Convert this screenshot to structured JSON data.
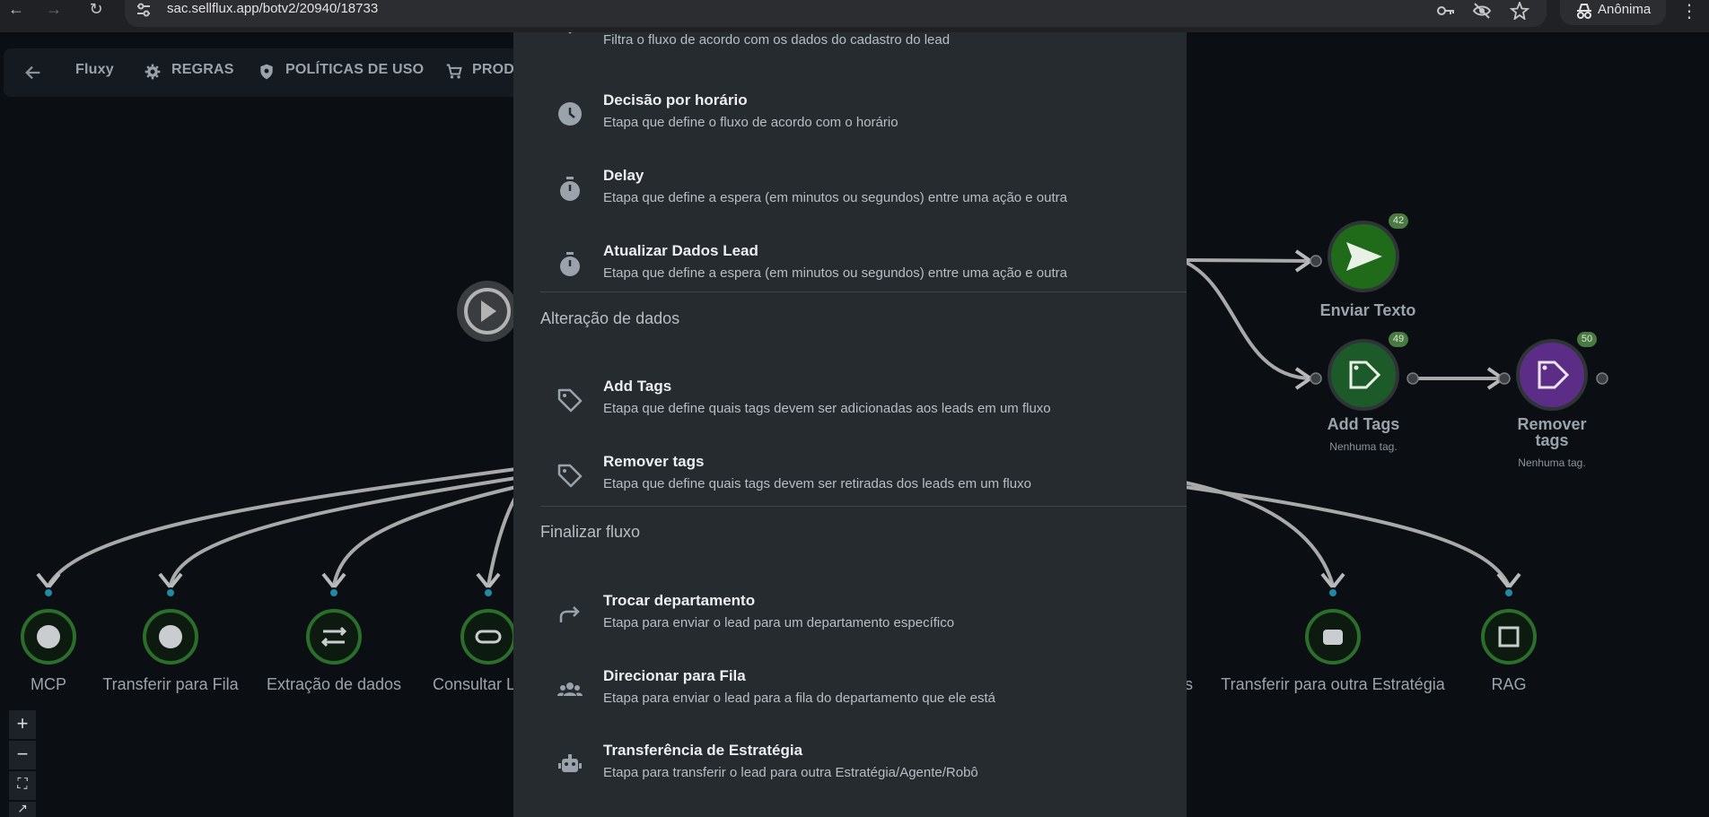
{
  "browser": {
    "url": "sac.sellflux.app/botv2/20940/18733",
    "profile_label": "Anônima"
  },
  "header": {
    "title": "Fluxy",
    "rules_label": "REGRAS",
    "policies_label": "POLÍTICAS DE USO",
    "products_label": "PROD"
  },
  "menu": {
    "top_partial_desc": "Filtra o fluxo de acordo com os dados do cadastro do lead",
    "group1_items": [
      {
        "title": "Decisão por horário",
        "desc": "Etapa que define o fluxo de acordo com o horário",
        "icon": "clock-icon"
      },
      {
        "title": "Delay",
        "desc": "Etapa que define a espera (em minutos ou segundos) entre uma ação e outra",
        "icon": "timer-icon"
      },
      {
        "title": "Atualizar Dados Lead",
        "desc": "Etapa que define a espera (em minutos ou segundos) entre uma ação e outra",
        "icon": "timer-icon"
      }
    ],
    "section_data_change": "Alteração de dados",
    "group2_items": [
      {
        "title": "Add Tags",
        "desc": "Etapa que define quais tags devem ser adicionadas aos leads em um fluxo",
        "icon": "tag-icon"
      },
      {
        "title": "Remover tags",
        "desc": "Etapa que define quais tags devem ser retiradas dos leads em um fluxo",
        "icon": "tag-icon"
      }
    ],
    "section_finalize": "Finalizar fluxo",
    "group3_items": [
      {
        "title": "Trocar departamento",
        "desc": "Etapa para enviar o lead para um departamento específico",
        "icon": "forward-arrow-icon"
      },
      {
        "title": "Direcionar para Fila",
        "desc": "Etapa para enviar o lead para a fila do departamento que ele está",
        "icon": "group-icon"
      },
      {
        "title": "Transferência de Estratégia",
        "desc": "Etapa para transferir o lead para outra Estratégia/Agente/Robô",
        "icon": "robot-icon"
      }
    ]
  },
  "flow": {
    "nodes_right": [
      {
        "label": "Enviar Texto",
        "badge": "42",
        "color": "#1f6b1a",
        "icon": "send-icon"
      },
      {
        "label": "Add Tags",
        "badge": "49",
        "sub": "Nenhuma tag.",
        "color": "#1d5a2a",
        "icon": "tag-icon"
      },
      {
        "label": "Remover tags",
        "label_line1": "Remover",
        "label_line2": "tags",
        "badge": "50",
        "sub": "Nenhuma tag.",
        "color": "#5b2d86",
        "icon": "tag-icon"
      }
    ],
    "nodes_bottom": [
      {
        "label": "MCP",
        "icon": "wrench-icon"
      },
      {
        "label": "Transferir para Fila",
        "icon": "account-icon"
      },
      {
        "label": "Extração de dados",
        "icon": "swap-icon"
      },
      {
        "label": "Consultar L",
        "icon": "link-icon"
      },
      {
        "label": "s",
        "icon": ""
      },
      {
        "label": "Transferir para outra Estratégia",
        "icon": "robot-icon"
      },
      {
        "label": "RAG",
        "icon": "scan-icon"
      }
    ],
    "zoom_in": "+",
    "zoom_out": "−",
    "fit": "⛶",
    "more": "↗"
  }
}
